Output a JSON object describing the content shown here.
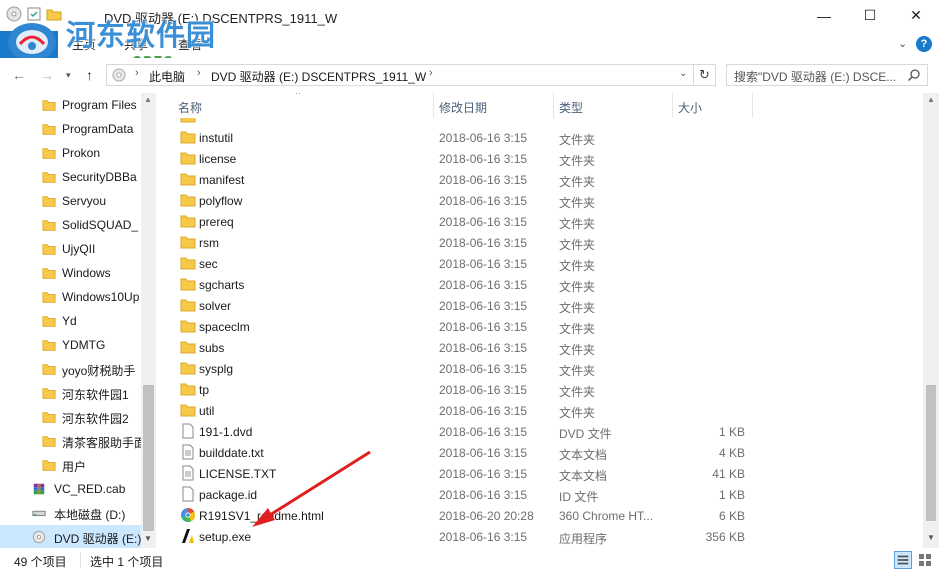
{
  "window": {
    "title": "DVD 驱动器 (E:) DSCENTPRS_1911_W",
    "min": "—",
    "max": "☐",
    "close": "✕"
  },
  "watermark": {
    "title": "河东软件园",
    "url": "www.pc0359.cn"
  },
  "ribbon": {
    "file": "文件",
    "home": "主页",
    "share": "共享",
    "view": "查看",
    "help": "?"
  },
  "address": {
    "pc": "此电脑",
    "drive": "DVD 驱动器 (E:) DSCENTPRS_1911_W",
    "separator": "›",
    "search_placeholder": "搜索\"DVD 驱动器 (E:) DSCE..."
  },
  "nav": {
    "items": [
      {
        "label": "Program Files",
        "icon": "folder-icon"
      },
      {
        "label": "ProgramData",
        "icon": "folder-icon"
      },
      {
        "label": "Prokon",
        "icon": "folder-icon"
      },
      {
        "label": "SecurityDBBa",
        "icon": "folder-icon"
      },
      {
        "label": "Servyou",
        "icon": "folder-icon"
      },
      {
        "label": "SolidSQUAD_",
        "icon": "folder-icon"
      },
      {
        "label": "UjyQII",
        "icon": "folder-icon"
      },
      {
        "label": "Windows",
        "icon": "folder-icon"
      },
      {
        "label": "Windows10Up",
        "icon": "folder-icon"
      },
      {
        "label": "Yd",
        "icon": "folder-icon"
      },
      {
        "label": "YDMTG",
        "icon": "folder-icon"
      },
      {
        "label": "yoyo财税助手",
        "icon": "folder-icon"
      },
      {
        "label": "河东软件园1",
        "icon": "folder-icon"
      },
      {
        "label": "河东软件园2",
        "icon": "folder-icon"
      },
      {
        "label": "清茶客服助手面",
        "icon": "folder-icon"
      },
      {
        "label": "用户",
        "icon": "folder-icon"
      },
      {
        "label": "VC_RED.cab",
        "icon": "archive-icon"
      },
      {
        "label": "本地磁盘 (D:)",
        "icon": "drive-icon"
      },
      {
        "label": "DVD 驱动器 (E:)",
        "icon": "dvd-drive-icon"
      }
    ]
  },
  "columns": {
    "name": "名称",
    "date": "修改日期",
    "type": "类型",
    "size": "大小"
  },
  "files": [
    {
      "name": "instutil",
      "date": "2018-06-16 3:15",
      "type": "文件夹",
      "size": "",
      "icon": "folder-icon"
    },
    {
      "name": "license",
      "date": "2018-06-16 3:15",
      "type": "文件夹",
      "size": "",
      "icon": "folder-icon"
    },
    {
      "name": "manifest",
      "date": "2018-06-16 3:15",
      "type": "文件夹",
      "size": "",
      "icon": "folder-icon"
    },
    {
      "name": "polyflow",
      "date": "2018-06-16 3:15",
      "type": "文件夹",
      "size": "",
      "icon": "folder-icon"
    },
    {
      "name": "prereq",
      "date": "2018-06-16 3:15",
      "type": "文件夹",
      "size": "",
      "icon": "folder-icon"
    },
    {
      "name": "rsm",
      "date": "2018-06-16 3:15",
      "type": "文件夹",
      "size": "",
      "icon": "folder-icon"
    },
    {
      "name": "sec",
      "date": "2018-06-16 3:15",
      "type": "文件夹",
      "size": "",
      "icon": "folder-icon"
    },
    {
      "name": "sgcharts",
      "date": "2018-06-16 3:15",
      "type": "文件夹",
      "size": "",
      "icon": "folder-icon"
    },
    {
      "name": "solver",
      "date": "2018-06-16 3:15",
      "type": "文件夹",
      "size": "",
      "icon": "folder-icon"
    },
    {
      "name": "spaceclm",
      "date": "2018-06-16 3:15",
      "type": "文件夹",
      "size": "",
      "icon": "folder-icon"
    },
    {
      "name": "subs",
      "date": "2018-06-16 3:15",
      "type": "文件夹",
      "size": "",
      "icon": "folder-icon"
    },
    {
      "name": "sysplg",
      "date": "2018-06-16 3:15",
      "type": "文件夹",
      "size": "",
      "icon": "folder-icon"
    },
    {
      "name": "tp",
      "date": "2018-06-16 3:15",
      "type": "文件夹",
      "size": "",
      "icon": "folder-icon"
    },
    {
      "name": "util",
      "date": "2018-06-16 3:15",
      "type": "文件夹",
      "size": "",
      "icon": "folder-icon"
    },
    {
      "name": "191-1.dvd",
      "date": "2018-06-16 3:15",
      "type": "DVD 文件",
      "size": "1 KB",
      "icon": "file-icon"
    },
    {
      "name": "builddate.txt",
      "date": "2018-06-16 3:15",
      "type": "文本文档",
      "size": "4 KB",
      "icon": "text-file-icon"
    },
    {
      "name": "LICENSE.TXT",
      "date": "2018-06-16 3:15",
      "type": "文本文档",
      "size": "41 KB",
      "icon": "text-file-icon"
    },
    {
      "name": "package.id",
      "date": "2018-06-16 3:15",
      "type": "ID 文件",
      "size": "1 KB",
      "icon": "file-icon"
    },
    {
      "name": "R191SV1_readme.html",
      "date": "2018-06-20 20:28",
      "type": "360 Chrome HT...",
      "size": "6 KB",
      "icon": "html-file-icon"
    },
    {
      "name": "setup.exe",
      "date": "2018-06-16 3:15",
      "type": "应用程序",
      "size": "356 KB",
      "icon": "setup-app-icon"
    }
  ],
  "status": {
    "count": "49 个项目",
    "selected": "选中 1 个项目"
  },
  "colors": {
    "accent": "#1979ca",
    "folder": "#f7c948",
    "selection": "#cce8ff",
    "annotation_arrow": "#e02020"
  }
}
